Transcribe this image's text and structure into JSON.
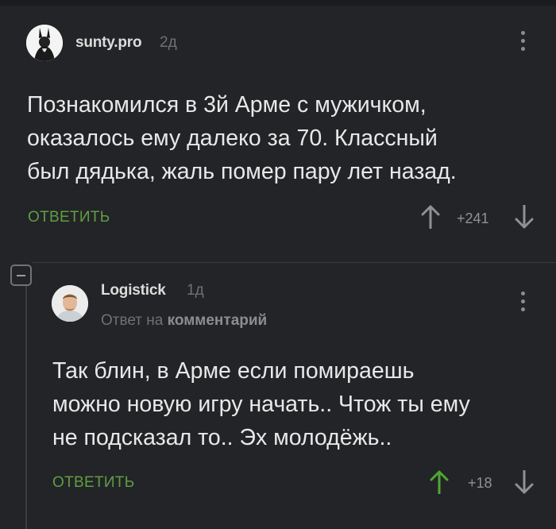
{
  "comments": [
    {
      "username": "sunty.pro",
      "time": "2д",
      "text": "Познакомился в 3й Арме с мужичком,\nоказалось ему далеко за 70. Классный\nбыл дядька, жаль помер пару лет назад.",
      "reply_label": "ОТВЕТИТЬ",
      "score": "+241"
    },
    {
      "username": "Logistick",
      "time": "1д",
      "reply_to_prefix": "Ответ на",
      "reply_to_target": "комментарий",
      "text": "Так блин, в Арме если помираешь\nможно новую игру начать.. Чтож ты ему\nне подсказал то.. Эх молодёжь..",
      "reply_label": "ОТВЕТИТЬ",
      "score": "+18"
    }
  ],
  "colors": {
    "background": "#232427",
    "reply_green": "#5f9e43",
    "upvote_active": "#4fa832",
    "muted": "#6f7175"
  },
  "icons": {
    "more": "kebab-icon",
    "upvote": "arrow-up-icon",
    "downvote": "arrow-down-icon",
    "collapse": "minus-icon"
  }
}
